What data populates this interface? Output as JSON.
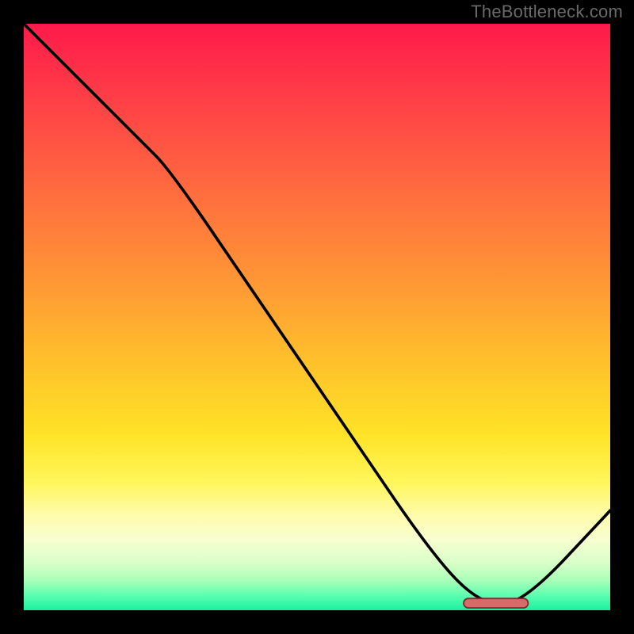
{
  "watermark": "TheBottleneck.com",
  "colors": {
    "background": "#000000",
    "curve_stroke": "#000000",
    "marker_fill": "#d86a6a",
    "marker_stroke": "#7a2f2f",
    "gradient_top": "#ff1a4b",
    "gradient_bottom": "#19f0a0",
    "watermark_text": "#6a6a6a"
  },
  "chart_data": {
    "type": "line",
    "title": "",
    "xlabel": "",
    "ylabel": "",
    "xlim": [
      0,
      100
    ],
    "ylim": [
      0,
      100
    ],
    "grid": false,
    "legend": false,
    "series": [
      {
        "name": "bottleneck-curve",
        "x": [
          0,
          10,
          20,
          25,
          40,
          55,
          70,
          78,
          85,
          100
        ],
        "y": [
          100,
          90,
          80,
          75,
          53,
          31,
          9,
          1,
          1,
          17
        ]
      }
    ],
    "annotations": [
      {
        "name": "optimal-range",
        "type": "bar",
        "x_start": 75,
        "x_end": 86,
        "y": 1
      }
    ]
  }
}
